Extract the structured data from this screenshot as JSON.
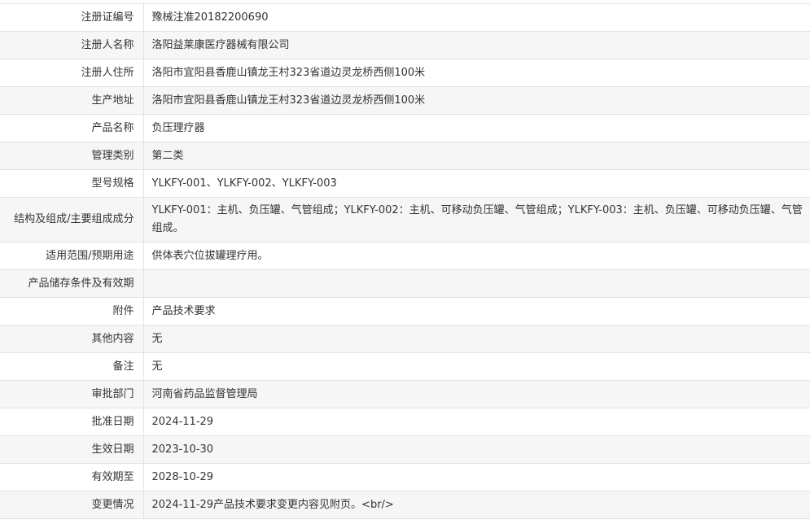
{
  "rows": [
    {
      "label": "注册证编号",
      "value": "豫械注准20182200690"
    },
    {
      "label": "注册人名称",
      "value": "洛阳益莱康医疗器械有限公司"
    },
    {
      "label": "注册人住所",
      "value": "洛阳市宜阳县香鹿山镇龙王村323省道边灵龙桥西侧100米"
    },
    {
      "label": "生产地址",
      "value": "洛阳市宜阳县香鹿山镇龙王村323省道边灵龙桥西侧100米"
    },
    {
      "label": "产品名称",
      "value": "负压理疗器"
    },
    {
      "label": "管理类别",
      "value": "第二类"
    },
    {
      "label": "型号规格",
      "value": "YLKFY-001、YLKFY-002、YLKFY-003"
    },
    {
      "label": "结构及组成/主要组成成分",
      "value": "YLKFY-001：主机、负压罐、气管组成；YLKFY-002：主机、可移动负压罐、气管组成；YLKFY-003：主机、负压罐、可移动负压罐、气管组成。"
    },
    {
      "label": "适用范围/预期用途",
      "value": "供体表穴位拔罐理疗用。"
    },
    {
      "label": "产品储存条件及有效期",
      "value": ""
    },
    {
      "label": "附件",
      "value": "产品技术要求"
    },
    {
      "label": "其他内容",
      "value": "无"
    },
    {
      "label": "备注",
      "value": "无"
    },
    {
      "label": "审批部门",
      "value": "河南省药品监督管理局"
    },
    {
      "label": "批准日期",
      "value": "2024-11-29"
    },
    {
      "label": "生效日期",
      "value": "2023-10-30"
    },
    {
      "label": "有效期至",
      "value": "2028-10-29"
    },
    {
      "label": "变更情况",
      "value": "2024-11-29产品技术要求变更内容见附页。<br/>"
    }
  ]
}
